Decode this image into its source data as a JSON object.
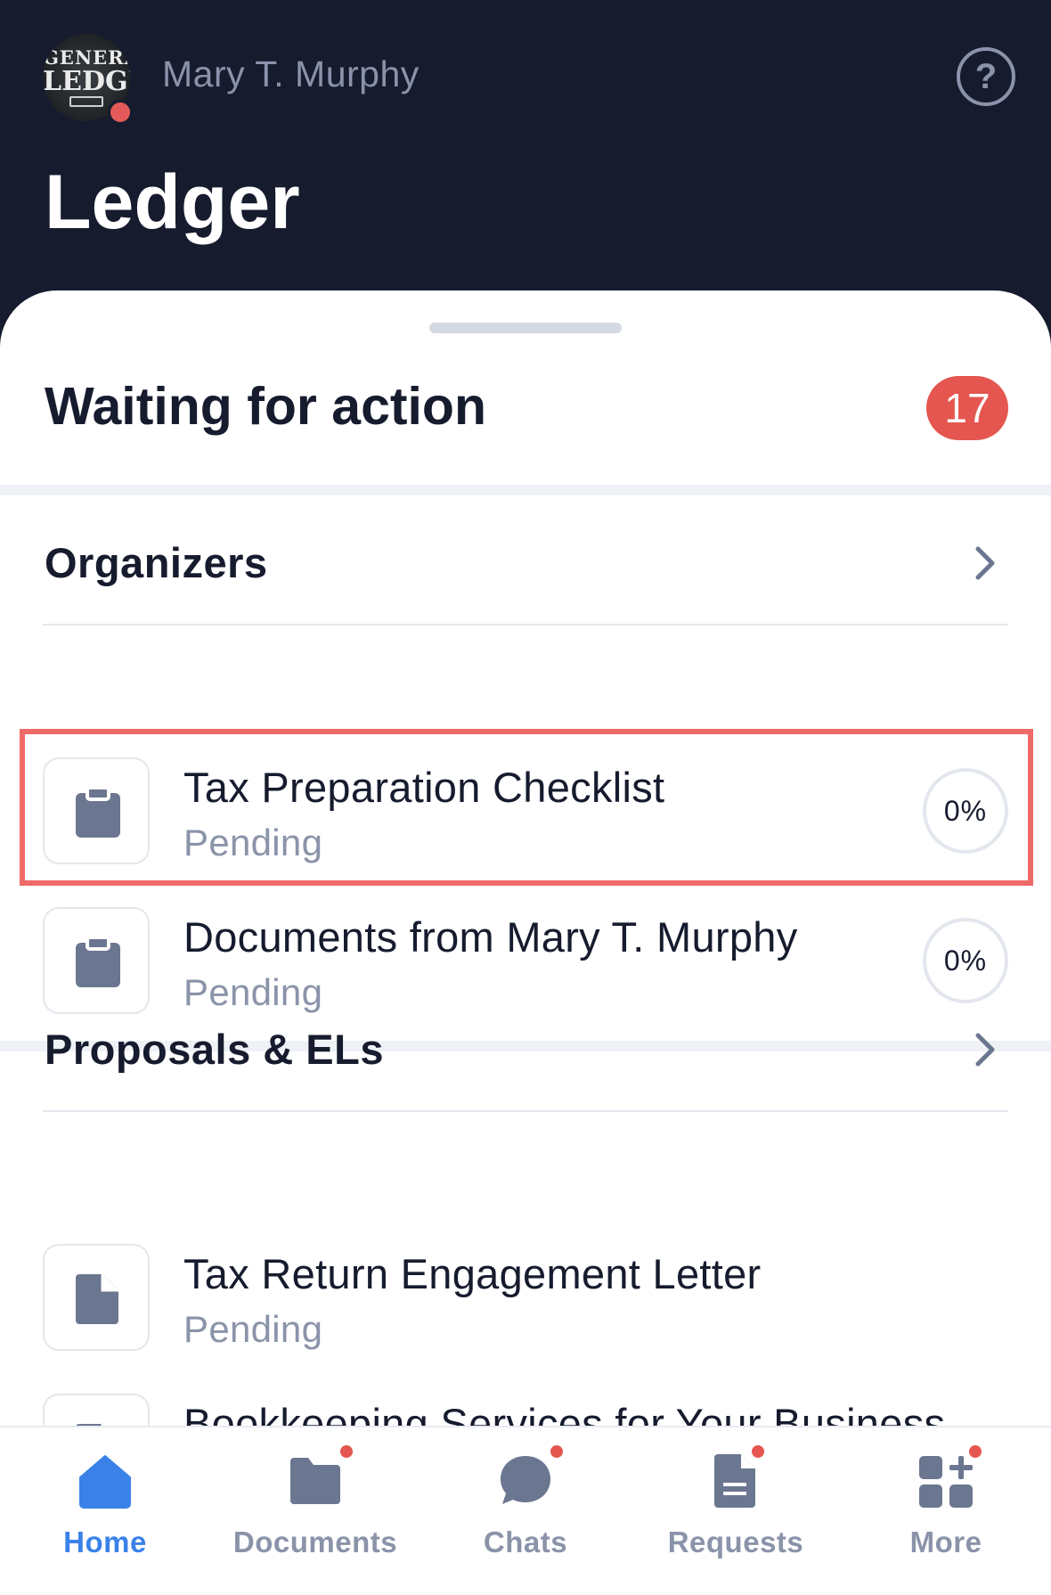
{
  "header": {
    "logo_text_top": "GENERAL",
    "logo_text_main": "LEDGER",
    "user_name": "Mary T. Murphy",
    "help_glyph": "?",
    "app_title": "Ledger"
  },
  "waiting": {
    "title": "Waiting for action",
    "count": "17"
  },
  "organizers": {
    "title": "Organizers",
    "items": [
      {
        "title": "Tax Preparation Checklist",
        "status": "Pending",
        "progress": "0%",
        "icon": "clipboard-icon"
      },
      {
        "title": "Documents from Mary T. Murphy",
        "status": "Pending",
        "progress": "0%",
        "icon": "clipboard-icon"
      }
    ]
  },
  "proposals": {
    "title": "Proposals & ELs",
    "items": [
      {
        "title": "Tax Return Engagement Letter",
        "status": "Pending",
        "icon": "document-icon"
      },
      {
        "title": "Bookkeeping Services for Your Business",
        "icon": "document-icon"
      }
    ]
  },
  "bottom_nav": {
    "items": [
      {
        "label": "Home",
        "icon": "home-icon",
        "active": true,
        "badge": false
      },
      {
        "label": "Documents",
        "icon": "folder-icon",
        "active": false,
        "badge": true
      },
      {
        "label": "Chats",
        "icon": "chat-icon",
        "active": false,
        "badge": true
      },
      {
        "label": "Requests",
        "icon": "request-document-icon",
        "active": false,
        "badge": true
      },
      {
        "label": "More",
        "icon": "apps-plus-icon",
        "active": false,
        "badge": true
      }
    ]
  },
  "colors": {
    "header_bg": "#161b2e",
    "accent_blue": "#3b82e8",
    "badge_red": "#e4564f",
    "highlight_border": "#ee6a66",
    "muted_text": "#8a93a9",
    "icon_gray": "#6b7690"
  }
}
